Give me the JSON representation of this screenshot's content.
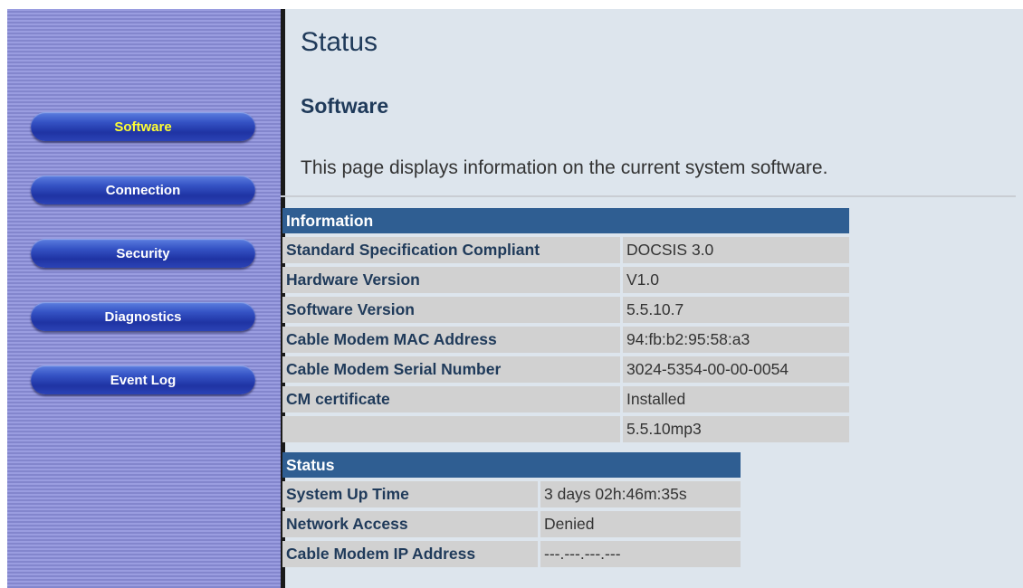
{
  "nav": {
    "items": [
      {
        "label": "Software"
      },
      {
        "label": "Connection"
      },
      {
        "label": "Security"
      },
      {
        "label": "Diagnostics"
      },
      {
        "label": "Event Log"
      }
    ],
    "active": "Software"
  },
  "page": {
    "title": "Status",
    "subtitle": "Software",
    "description": "This page displays information on the current system software."
  },
  "information": {
    "header": "Information",
    "rows": [
      {
        "label": "Standard Specification Compliant",
        "value": "DOCSIS 3.0"
      },
      {
        "label": "Hardware Version",
        "value": "V1.0"
      },
      {
        "label": "Software Version",
        "value": "5.5.10.7"
      },
      {
        "label": "Cable Modem MAC Address",
        "value": "94:fb:b2:95:58:a3"
      },
      {
        "label": "Cable Modem Serial Number",
        "value": "3024-5354-00-00-0054"
      },
      {
        "label": "CM certificate",
        "value": "Installed"
      },
      {
        "label": "",
        "value": "5.5.10mp3"
      }
    ]
  },
  "status": {
    "header": "Status",
    "rows": [
      {
        "label": "System Up Time",
        "value": "3 days 02h:46m:35s"
      },
      {
        "label": "Network Access",
        "value": "Denied"
      },
      {
        "label": "Cable Modem IP Address",
        "value": "---.---.---.---"
      }
    ]
  },
  "colors": {
    "table_header": "#2f5e92",
    "cell_background": "#d1d1d1",
    "page_background": "#dde5ed",
    "active_nav_text": "#ffff33"
  }
}
